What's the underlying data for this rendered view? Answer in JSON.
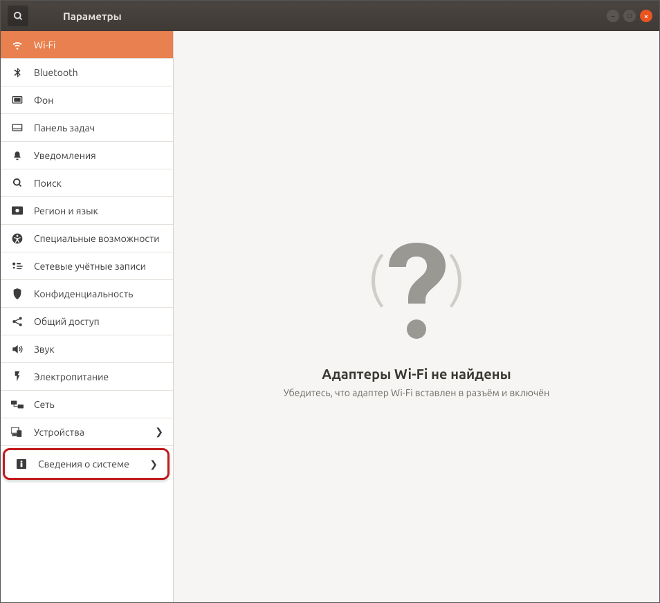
{
  "header": {
    "title": "Параметры"
  },
  "sidebar": {
    "items": [
      {
        "label": "Wi-Fi",
        "icon": "wifi-icon",
        "active": true,
        "arrow": false
      },
      {
        "label": "Bluetooth",
        "icon": "bluetooth-icon",
        "active": false,
        "arrow": false
      },
      {
        "label": "Фон",
        "icon": "background-icon",
        "active": false,
        "arrow": false
      },
      {
        "label": "Панель задач",
        "icon": "dock-icon",
        "active": false,
        "arrow": false
      },
      {
        "label": "Уведомления",
        "icon": "bell-icon",
        "active": false,
        "arrow": false
      },
      {
        "label": "Поиск",
        "icon": "search-icon",
        "active": false,
        "arrow": false
      },
      {
        "label": "Регион и язык",
        "icon": "region-icon",
        "active": false,
        "arrow": false
      },
      {
        "label": "Специальные возможности",
        "icon": "accessibility-icon",
        "active": false,
        "arrow": false
      },
      {
        "label": "Сетевые учётные записи",
        "icon": "accounts-icon",
        "active": false,
        "arrow": false
      },
      {
        "label": "Конфиденциальность",
        "icon": "privacy-icon",
        "active": false,
        "arrow": false
      },
      {
        "label": "Общий доступ",
        "icon": "share-icon",
        "active": false,
        "arrow": false
      },
      {
        "label": "Звук",
        "icon": "sound-icon",
        "active": false,
        "arrow": false
      },
      {
        "label": "Электропитание",
        "icon": "power-icon",
        "active": false,
        "arrow": false
      },
      {
        "label": "Сеть",
        "icon": "network-icon",
        "active": false,
        "arrow": false
      },
      {
        "label": "Устройства",
        "icon": "devices-icon",
        "active": false,
        "arrow": true
      },
      {
        "label": "Сведения о системе",
        "icon": "info-icon",
        "active": false,
        "arrow": true,
        "highlighted": true
      }
    ]
  },
  "content": {
    "title": "Адаптеры Wi-Fi не найдены",
    "subtitle": "Убедитесь, что адаптер Wi-Fi вставлен в разъём и включён"
  },
  "icons": {
    "wifi-icon": "📶",
    "bluetooth-icon": "ᚼ",
    "background-icon": "▣",
    "dock-icon": "◻",
    "bell-icon": "🔔",
    "search-icon": "🔍",
    "region-icon": "📷",
    "accessibility-icon": "✪",
    "accounts-icon": "⇢",
    "privacy-icon": "✋",
    "share-icon": "⟲",
    "sound-icon": "🔊",
    "power-icon": "⚡",
    "network-icon": "🖧",
    "devices-icon": "⎚",
    "info-icon": "ℹ"
  },
  "chevron": "❯"
}
